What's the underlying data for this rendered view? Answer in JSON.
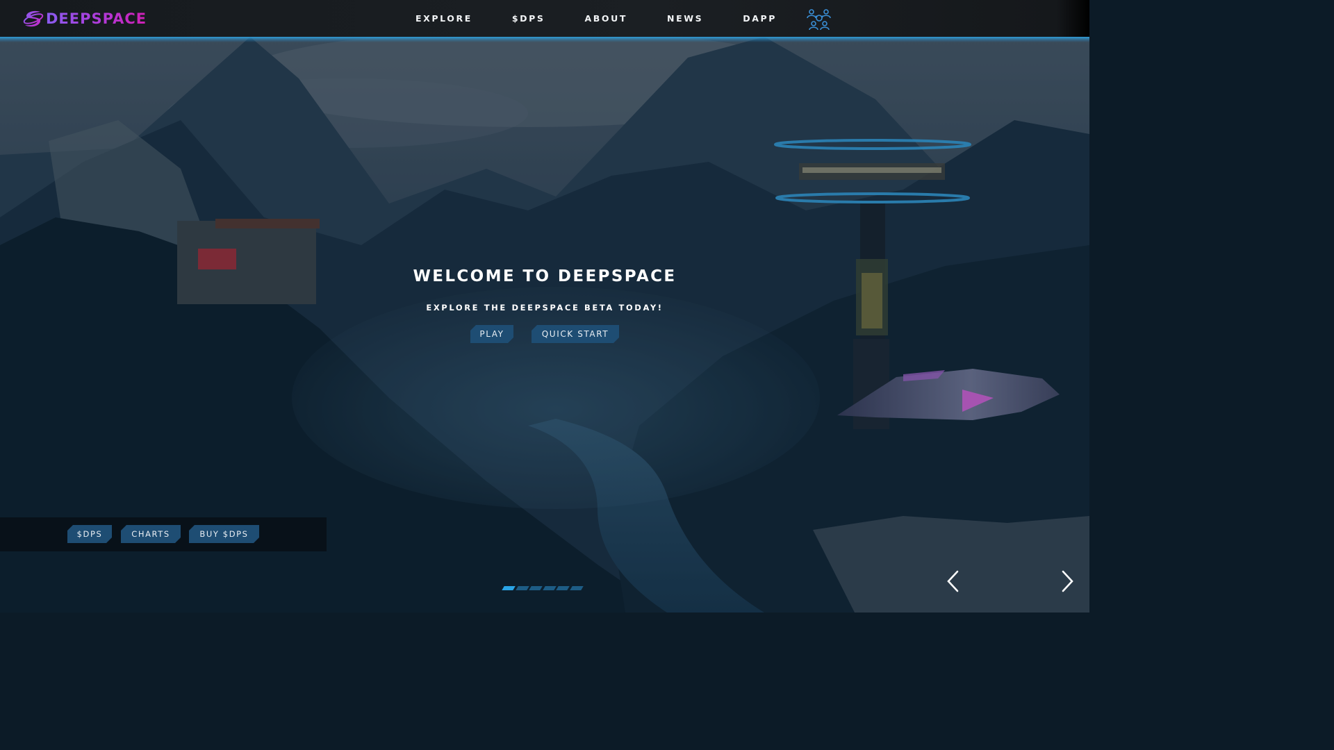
{
  "header": {
    "logo_text": "DEEPSPACE",
    "nav": [
      {
        "label": "EXPLORE"
      },
      {
        "label": "$DPS"
      },
      {
        "label": "ABOUT"
      },
      {
        "label": "NEWS"
      },
      {
        "label": "DAPP"
      }
    ],
    "community_icon": "community-network-icon"
  },
  "hero": {
    "title": "WELCOME TO DEEPSPACE",
    "subtitle": "EXPLORE THE DEEPSPACE BETA TODAY!",
    "play_label": "PLAY",
    "quick_start_label": "QUICK START"
  },
  "quick_links": [
    {
      "label": "$DPS"
    },
    {
      "label": "CHARTS"
    },
    {
      "label": "BUY $DPS"
    }
  ],
  "carousel": {
    "slide_count": 6,
    "active_slide": 1,
    "prev_icon": "chevron-left-icon",
    "next_icon": "chevron-right-icon"
  },
  "colors": {
    "accent": "#2aa4e6",
    "button": "#1e4d73",
    "logo_gradient_start": "#8a5cf0",
    "logo_gradient_end": "#d01fb5",
    "header_bg": "#1b1f23"
  }
}
